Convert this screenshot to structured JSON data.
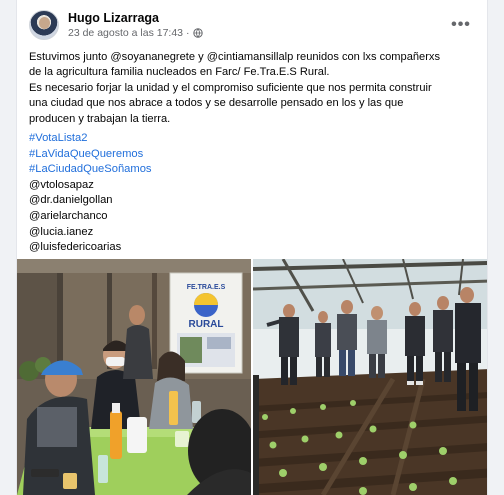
{
  "post": {
    "author": "Hugo Lizarraga",
    "timestamp": "23 de agosto a las 17:43",
    "separator": "·",
    "privacy_icon": "globe-icon",
    "more_label": "•••",
    "body_lines": [
      "Estuvimos junto @soyananegrete y @cintiamansillalp reunidos con lxs compañerxs",
      "de la agricultura familia nucleados en Farc/ Fe.Tra.E.S Rural.",
      " Es necesario forjar la unidad y el compromiso suficiente que nos permita construir",
      "una ciudad que nos abrace a todos y se desarrolle pensado en los y las que",
      "producen y trabajan la tierra."
    ],
    "hashtags": [
      "#VotaLista2",
      "#LaVidaQueQueremos",
      "#LaCiudadQueSoñamos"
    ],
    "mentions": [
      "@vtolosapaz",
      "@dr.danielgollan",
      "@arielarchanco",
      "@lucia.ianez",
      "@luisfedericoarias"
    ]
  },
  "photos": {
    "left_sign_top": "FE.TRA.E.S",
    "left_sign_main": "RURAL"
  },
  "colors": {
    "link": "#216fdb",
    "meta": "#65676b",
    "text": "#050505",
    "page_bg": "#f0f2f5"
  }
}
